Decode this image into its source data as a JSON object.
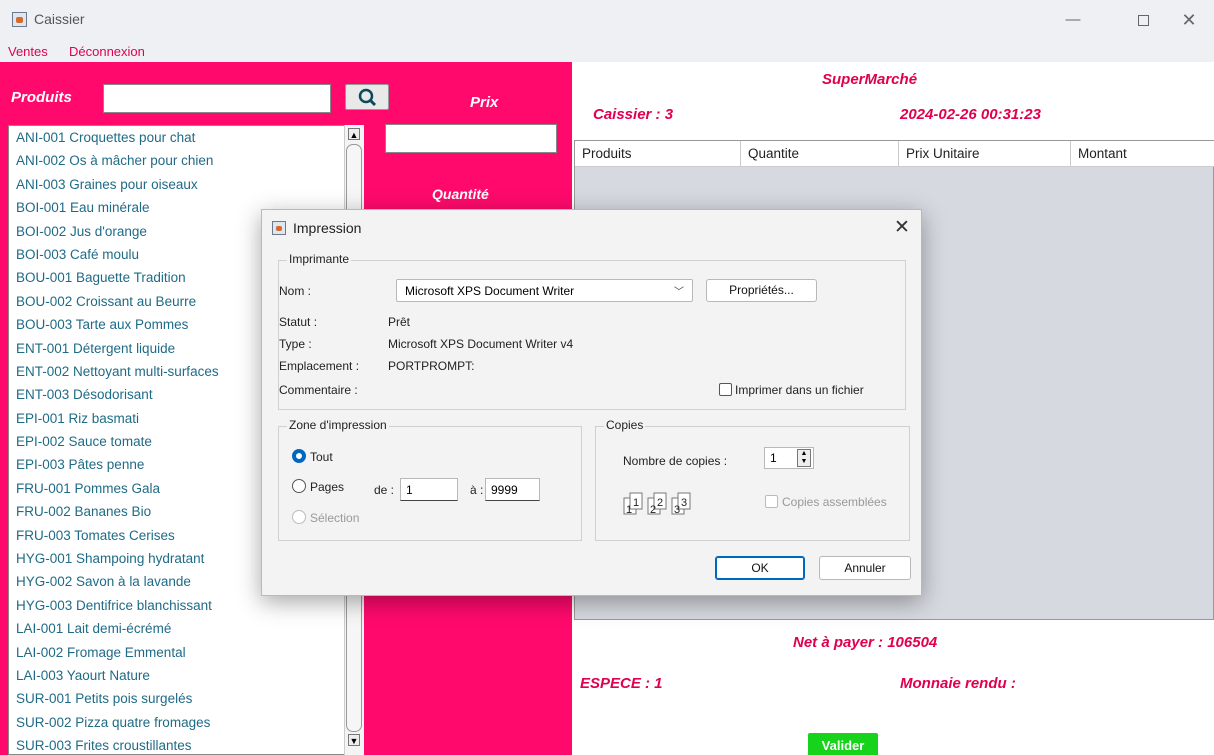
{
  "window": {
    "title": "Caissier"
  },
  "menu": {
    "items": [
      "Ventes",
      "Déconnexion"
    ]
  },
  "left": {
    "produits_label": "Produits",
    "prix_label": "Prix",
    "quantite_label": "Quantité",
    "products": [
      "ANI-001  Croquettes pour chat",
      "ANI-002  Os à mâcher pour chien",
      "ANI-003  Graines pour oiseaux",
      "BOI-001  Eau minérale",
      "BOI-002  Jus d'orange",
      "BOI-003  Café moulu",
      "BOU-001  Baguette Tradition",
      "BOU-002  Croissant au Beurre",
      "BOU-003  Tarte aux Pommes",
      "ENT-001  Détergent liquide",
      "ENT-002  Nettoyant multi-surfaces",
      "ENT-003  Désodorisant",
      "EPI-001  Riz basmati",
      "EPI-002  Sauce tomate",
      "EPI-003  Pâtes penne",
      "FRU-001  Pommes Gala",
      "FRU-002  Bananes Bio",
      "FRU-003  Tomates Cerises",
      "HYG-001  Shampoing hydratant",
      "HYG-002  Savon à la lavande",
      "HYG-003  Dentifrice blanchissant",
      "LAI-001  Lait demi-écrémé",
      "LAI-002  Fromage Emmental",
      "LAI-003  Yaourt Nature",
      "SUR-001  Petits pois surgelés",
      "SUR-002  Pizza quatre fromages",
      "SUR-003  Frites croustillantes"
    ]
  },
  "right": {
    "store_name": "SuperMarché",
    "caissier": "Caissier : 3",
    "datetime": "2024-02-26 00:31:23",
    "table_headers": [
      "Produits",
      "Quantite",
      "Prix Unitaire",
      "Montant"
    ],
    "net_a_payer": "Net à payer : 106504",
    "espece": "ESPECE  :  1",
    "monnaie_rendu": "Monnaie rendu :",
    "valider_label": "Valider"
  },
  "dialog": {
    "title": "Impression",
    "imprimante": {
      "legend": "Imprimante",
      "nom_label": "Nom :",
      "nom_value": "Microsoft XPS Document Writer",
      "proprietes_label": "Propriétés...",
      "statut_label": "Statut :",
      "statut_value": "Prêt",
      "type_label": "Type :",
      "type_value": "Microsoft XPS Document Writer v4",
      "emplacement_label": "Emplacement :",
      "emplacement_value": "PORTPROMPT:",
      "commentaire_label": "Commentaire :",
      "imprimer_fichier_label": "Imprimer dans un fichier"
    },
    "zone": {
      "legend": "Zone d'impression",
      "tout_label": "Tout",
      "pages_label": "Pages",
      "de_label": "de :",
      "de_value": "1",
      "a_label": "à :",
      "a_value": "9999",
      "selection_label": "Sélection"
    },
    "copies": {
      "legend": "Copies",
      "nombre_label": "Nombre de copies :",
      "nombre_value": "1",
      "assemblees_label": "Copies assemblées"
    },
    "ok_label": "OK",
    "annuler_label": "Annuler"
  },
  "colors": {
    "pink_panel": "#ff0a6c",
    "pink_text": "#e0004f",
    "teal_text": "#0d6a6a",
    "valider_green": "#17d31c"
  }
}
